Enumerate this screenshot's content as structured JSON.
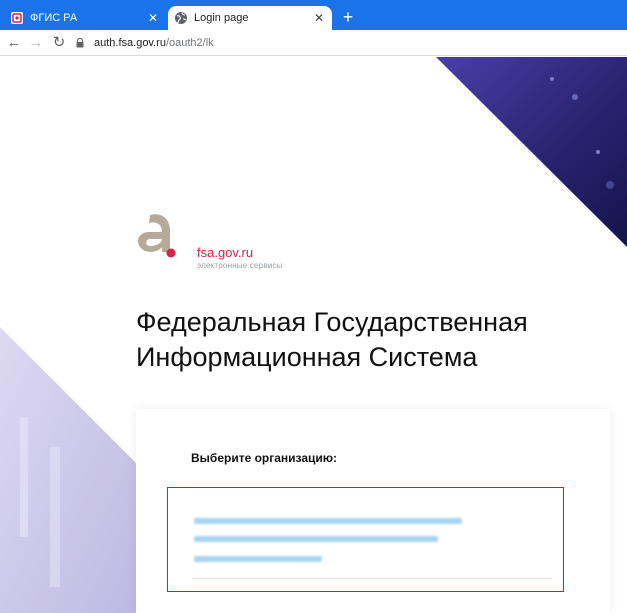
{
  "browser": {
    "tabs": [
      {
        "title": "ФГИС РА",
        "active": false,
        "favicon": "fgis-ra-favicon"
      },
      {
        "title": "Login page",
        "active": true,
        "favicon": "globe-icon"
      }
    ],
    "new_tab_symbol": "+",
    "close_symbol": "✕",
    "nav": {
      "back": "←",
      "forward": "→",
      "reload": "↻"
    },
    "url_host": "auth.fsa.gov.ru",
    "url_path": "/oauth2/lk",
    "accent_color": "#1a73e8"
  },
  "page": {
    "brand": "fsa.gov.ru",
    "brand_sub": "электронные сервисы",
    "brand_color": "#d6224b",
    "title_lines": [
      "Федеральная Государственная",
      "Информационная Система"
    ],
    "select_label": "Выберите организацию:",
    "highlight_color": "#c9211e"
  }
}
